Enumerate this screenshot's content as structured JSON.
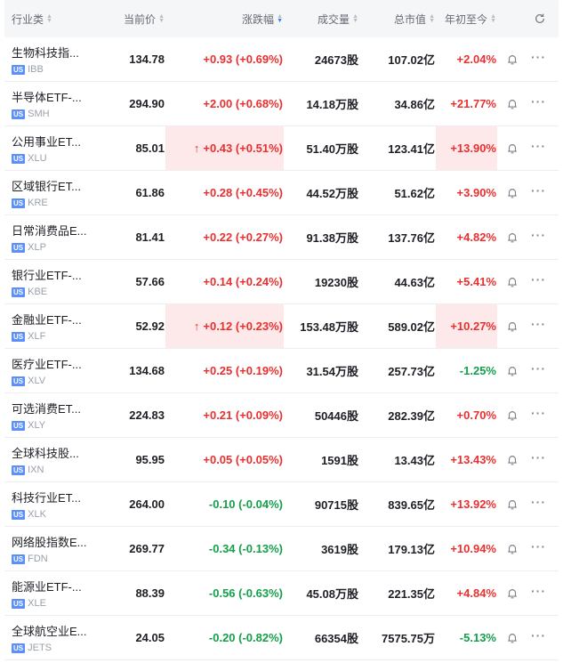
{
  "header": {
    "category": "行业类",
    "price": "当前价",
    "change": "涨跌幅",
    "volume": "成交量",
    "market_cap": "总市值",
    "ytd": "年初至今"
  },
  "market_tag": "US",
  "colors": {
    "up": "#e93030",
    "down": "#14a04b",
    "highlight": "#fde9e9",
    "tag": "#5b8ff9"
  },
  "rows": [
    {
      "name": "生物科技指...",
      "code": "IBB",
      "price": "134.78",
      "change": "+0.93 (+0.69%)",
      "change_dir": "up",
      "change_highlight": false,
      "volume": "24673股",
      "market_cap": "107.02亿",
      "ytd": "+2.04%",
      "ytd_dir": "up",
      "ytd_highlight": false
    },
    {
      "name": "半导体ETF-...",
      "code": "SMH",
      "price": "294.90",
      "change": "+2.00 (+0.68%)",
      "change_dir": "up",
      "change_highlight": false,
      "volume": "14.18万股",
      "market_cap": "34.86亿",
      "ytd": "+21.77%",
      "ytd_dir": "up",
      "ytd_highlight": false
    },
    {
      "name": "公用事业ET...",
      "code": "XLU",
      "price": "85.01",
      "change": "+0.43 (+0.51%)",
      "change_dir": "up",
      "change_highlight": true,
      "volume": "51.40万股",
      "market_cap": "123.41亿",
      "ytd": "+13.90%",
      "ytd_dir": "up",
      "ytd_highlight": true
    },
    {
      "name": "区域银行ET...",
      "code": "KRE",
      "price": "61.86",
      "change": "+0.28 (+0.45%)",
      "change_dir": "up",
      "change_highlight": false,
      "volume": "44.52万股",
      "market_cap": "51.62亿",
      "ytd": "+3.90%",
      "ytd_dir": "up",
      "ytd_highlight": false
    },
    {
      "name": "日常消费品E...",
      "code": "XLP",
      "price": "81.41",
      "change": "+0.22 (+0.27%)",
      "change_dir": "up",
      "change_highlight": false,
      "volume": "91.38万股",
      "market_cap": "137.76亿",
      "ytd": "+4.82%",
      "ytd_dir": "up",
      "ytd_highlight": false
    },
    {
      "name": "银行业ETF-...",
      "code": "KBE",
      "price": "57.66",
      "change": "+0.14 (+0.24%)",
      "change_dir": "up",
      "change_highlight": false,
      "volume": "19230股",
      "market_cap": "44.63亿",
      "ytd": "+5.41%",
      "ytd_dir": "up",
      "ytd_highlight": false
    },
    {
      "name": "金融业ETF-...",
      "code": "XLF",
      "price": "52.92",
      "change": "+0.12 (+0.23%)",
      "change_dir": "up",
      "change_highlight": true,
      "volume": "153.48万股",
      "market_cap": "589.02亿",
      "ytd": "+10.27%",
      "ytd_dir": "up",
      "ytd_highlight": true
    },
    {
      "name": "医疗业ETF-...",
      "code": "XLV",
      "price": "134.68",
      "change": "+0.25 (+0.19%)",
      "change_dir": "up",
      "change_highlight": false,
      "volume": "31.54万股",
      "market_cap": "257.73亿",
      "ytd": "-1.25%",
      "ytd_dir": "down",
      "ytd_highlight": false
    },
    {
      "name": "可选消费ET...",
      "code": "XLY",
      "price": "224.83",
      "change": "+0.21 (+0.09%)",
      "change_dir": "up",
      "change_highlight": false,
      "volume": "50446股",
      "market_cap": "282.39亿",
      "ytd": "+0.70%",
      "ytd_dir": "up",
      "ytd_highlight": false
    },
    {
      "name": "全球科技股...",
      "code": "IXN",
      "price": "95.95",
      "change": "+0.05 (+0.05%)",
      "change_dir": "up",
      "change_highlight": false,
      "volume": "1591股",
      "market_cap": "13.43亿",
      "ytd": "+13.43%",
      "ytd_dir": "up",
      "ytd_highlight": false
    },
    {
      "name": "科技行业ET...",
      "code": "XLK",
      "price": "264.00",
      "change": "-0.10 (-0.04%)",
      "change_dir": "down",
      "change_highlight": false,
      "volume": "90715股",
      "market_cap": "839.65亿",
      "ytd": "+13.92%",
      "ytd_dir": "up",
      "ytd_highlight": false
    },
    {
      "name": "网络股指数E...",
      "code": "FDN",
      "price": "269.77",
      "change": "-0.34 (-0.13%)",
      "change_dir": "down",
      "change_highlight": false,
      "volume": "3619股",
      "market_cap": "179.13亿",
      "ytd": "+10.94%",
      "ytd_dir": "up",
      "ytd_highlight": false
    },
    {
      "name": "能源业ETF-...",
      "code": "XLE",
      "price": "88.39",
      "change": "-0.56 (-0.63%)",
      "change_dir": "down",
      "change_highlight": false,
      "volume": "45.08万股",
      "market_cap": "221.35亿",
      "ytd": "+4.84%",
      "ytd_dir": "up",
      "ytd_highlight": false
    },
    {
      "name": "全球航空业E...",
      "code": "JETS",
      "price": "24.05",
      "change": "-0.20 (-0.82%)",
      "change_dir": "down",
      "change_highlight": false,
      "volume": "66354股",
      "market_cap": "7575.75万",
      "ytd": "-5.13%",
      "ytd_dir": "down",
      "ytd_highlight": false
    }
  ]
}
